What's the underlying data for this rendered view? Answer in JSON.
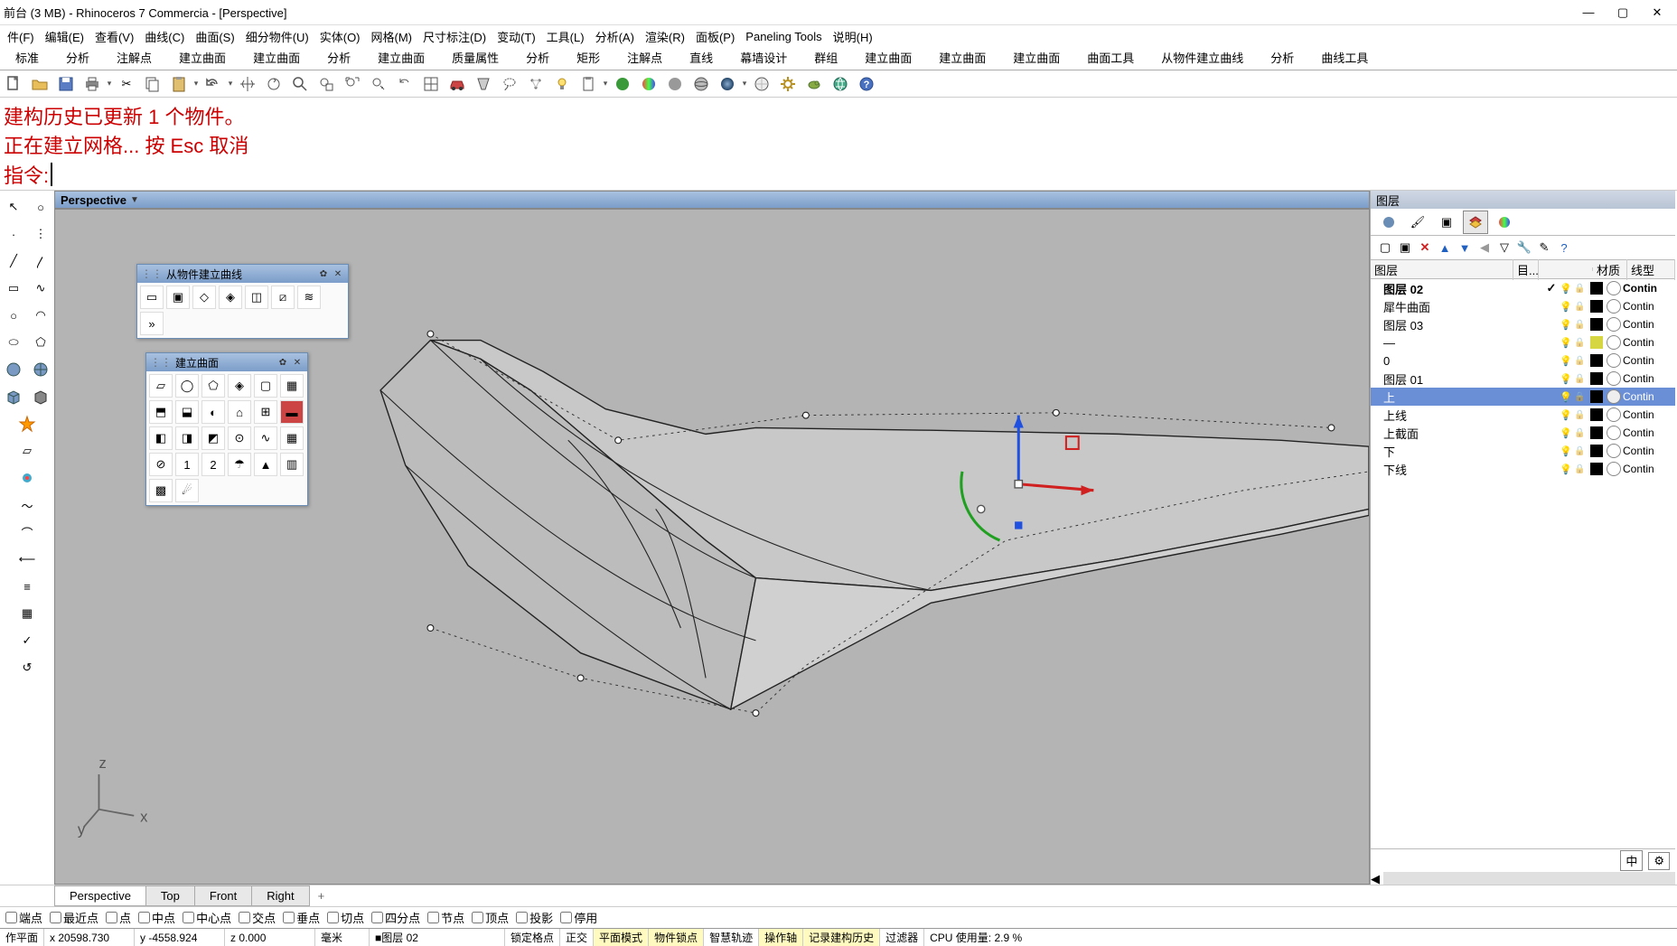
{
  "title": "前台 (3 MB) - Rhinoceros 7 Commercia - [Perspective]",
  "menus": [
    "件(F)",
    "编辑(E)",
    "查看(V)",
    "曲线(C)",
    "曲面(S)",
    "细分物件(U)",
    "实体(O)",
    "网格(M)",
    "尺寸标注(D)",
    "变动(T)",
    "工具(L)",
    "分析(A)",
    "渲染(R)",
    "面板(P)",
    "Paneling Tools",
    "说明(H)"
  ],
  "tabs": [
    "标准",
    "分析",
    "注解点",
    "建立曲面",
    "建立曲面",
    "分析",
    "建立曲面",
    "质量属性",
    "分析",
    "矩形",
    "注解点",
    "直线",
    "幕墙设计",
    "群组",
    "建立曲面",
    "建立曲面",
    "建立曲面",
    "曲面工具",
    "从物件建立曲线",
    "分析",
    "曲线工具"
  ],
  "cmd_history1": "建构历史已更新 1 个物件。",
  "cmd_history2": "正在建立网格... 按 Esc 取消",
  "cmd_prompt": "指令:",
  "viewport_title": "Perspective",
  "float1_title": "从物件建立曲线",
  "float2_title": "建立曲面",
  "viewtabs": [
    "Perspective",
    "Top",
    "Front",
    "Right"
  ],
  "osnaps": [
    "端点",
    "最近点",
    "点",
    "中点",
    "中心点",
    "交点",
    "垂点",
    "切点",
    "四分点",
    "节点",
    "顶点",
    "投影",
    "停用"
  ],
  "status": {
    "plane": "作平面",
    "x": "x 20598.730",
    "y": "y -4558.924",
    "z": "z 0.000",
    "unit": "毫米",
    "layer": "图层 02",
    "grid": "锁定格点",
    "ortho": "正交",
    "planar": "平面模式",
    "osnap": "物件锁点",
    "smart": "智慧轨迹",
    "gumball": "操作轴",
    "history": "记录建构历史",
    "filter": "过滤器",
    "cpu": "CPU 使用量: 2.9 %"
  },
  "rpanel_title": "图层",
  "layer_cols": {
    "layer": "图层",
    "cur": "目...",
    "mat": "材质",
    "lt": "线型"
  },
  "layers": [
    {
      "name": "图层 02",
      "bold": true,
      "current": true,
      "bulb": true,
      "lock": true,
      "color": "#000",
      "lt": "Contin"
    },
    {
      "name": "犀牛曲面",
      "bulb": true,
      "lock": true,
      "color": "#000",
      "lt": "Contin"
    },
    {
      "name": "图层 03",
      "bulb": true,
      "lock": true,
      "color": "#000",
      "lt": "Contin"
    },
    {
      "name": "—",
      "bulb": true,
      "lock": true,
      "color": "#d6d642",
      "lt": "Contin"
    },
    {
      "name": "0",
      "bulb": true,
      "lock": true,
      "color": "#000",
      "lt": "Contin"
    },
    {
      "name": "图层 01",
      "bulb": true,
      "lock": true,
      "color": "#000",
      "lt": "Contin"
    },
    {
      "name": "上",
      "selected": true,
      "bulb": true,
      "lock": true,
      "color": "#000",
      "mat": true,
      "lt": "Contin"
    },
    {
      "name": "上线",
      "bulb": true,
      "lock": true,
      "color": "#000",
      "lt": "Contin"
    },
    {
      "name": "上截面",
      "bulb": true,
      "lock": true,
      "color": "#000",
      "lt": "Contin"
    },
    {
      "name": "下",
      "bulb": true,
      "lock": true,
      "color": "#000",
      "lt": "Contin"
    },
    {
      "name": "下线",
      "bulb": true,
      "lock": true,
      "color": "#000",
      "lt": "Contin"
    }
  ],
  "rfooter": "中"
}
